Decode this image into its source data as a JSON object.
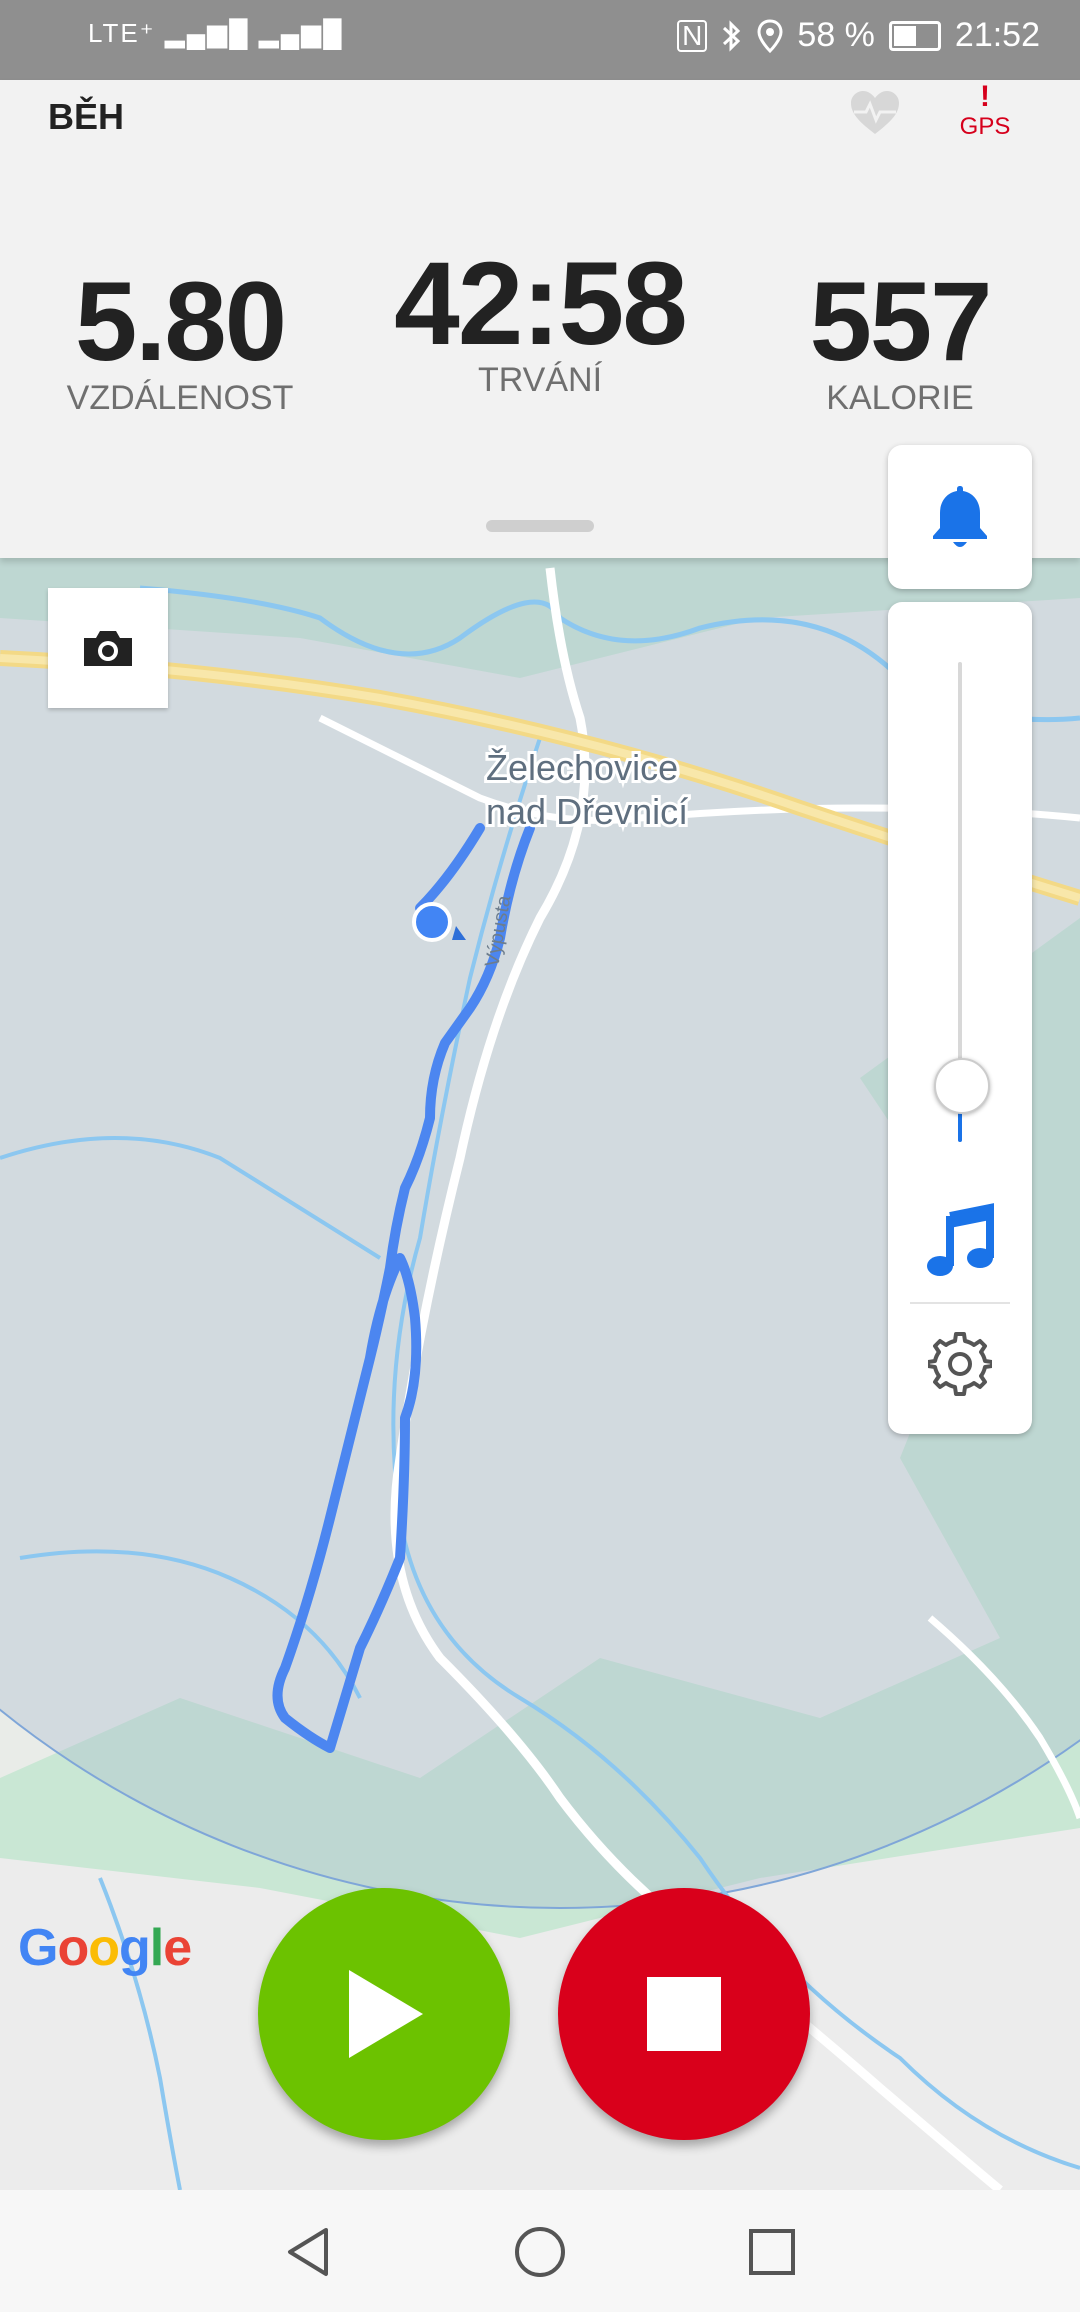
{
  "status_bar": {
    "network_left": "LTE⁺ ▂▄▆█  ▂▄▆█",
    "battery_percent": "58 %",
    "battery_level": 0.58,
    "time": "21:52",
    "icons": [
      "nfc-icon",
      "bluetooth-icon",
      "location-icon",
      "battery-icon"
    ]
  },
  "header": {
    "activity": "BĚH",
    "heart_icon": "heart-rate-icon",
    "gps_label": "GPS",
    "gps_alert": "!",
    "gps_color": "#d6001c"
  },
  "stats": [
    {
      "value": "5.80",
      "label": "VZDÁLENOST"
    },
    {
      "value": "42:58",
      "label": "TRVÁNÍ"
    },
    {
      "value": "557",
      "label": "KALORIE"
    }
  ],
  "map": {
    "town_line1": "Želechovice",
    "town_line2": "nad Dřevnicí",
    "street": "Výpusta",
    "google_logo": {
      "G": "G",
      "o1": "o",
      "o2": "o",
      "g": "g",
      "l": "l",
      "e": "e"
    },
    "route_color": "#4285f4"
  },
  "controls": {
    "camera_icon": "camera-icon",
    "bell_icon": "bell-icon",
    "volume_level": 0.08,
    "music_icon": "music-note-icon",
    "settings_icon": "gear-icon",
    "accent": "#1a73e8"
  },
  "actions": {
    "play_color": "#6cc200",
    "stop_color": "#d9001b"
  },
  "nav": [
    "back-icon",
    "home-icon",
    "recents-icon"
  ]
}
